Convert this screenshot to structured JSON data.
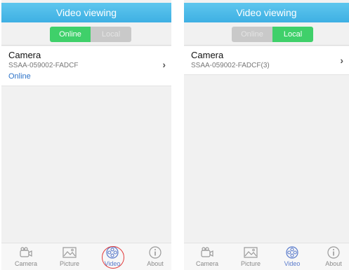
{
  "screens": [
    {
      "header_title": "Video viewing",
      "segment": {
        "online_label": "Online",
        "local_label": "Local",
        "selected": "online"
      },
      "item": {
        "title": "Camera",
        "subtitle": "SSAA-059002-FADCF",
        "status": "Online"
      },
      "tabs": [
        {
          "label": "Camera",
          "icon": "camera-icon"
        },
        {
          "label": "Picture",
          "icon": "picture-icon"
        },
        {
          "label": "Video",
          "icon": "video-icon",
          "active": true,
          "highlighted": true
        },
        {
          "label": "About",
          "icon": "info-icon"
        }
      ]
    },
    {
      "header_title": "Video viewing",
      "segment": {
        "online_label": "Online",
        "local_label": "Local",
        "selected": "local"
      },
      "item": {
        "title": "Camera",
        "subtitle": "SSAA-059002-FADCF(3)"
      },
      "tabs": [
        {
          "label": "Camera",
          "icon": "camera-icon"
        },
        {
          "label": "Picture",
          "icon": "picture-icon"
        },
        {
          "label": "Video",
          "icon": "video-icon",
          "active": true
        },
        {
          "label": "About",
          "icon": "info-icon"
        }
      ]
    }
  ],
  "colors": {
    "header": "#4bb9e8",
    "segment_active": "#3fd06a",
    "segment_inactive": "#c9c9c9",
    "status_link": "#2e74c9",
    "tab_active": "#5a7bcc",
    "highlight_circle": "#e23b3b"
  }
}
